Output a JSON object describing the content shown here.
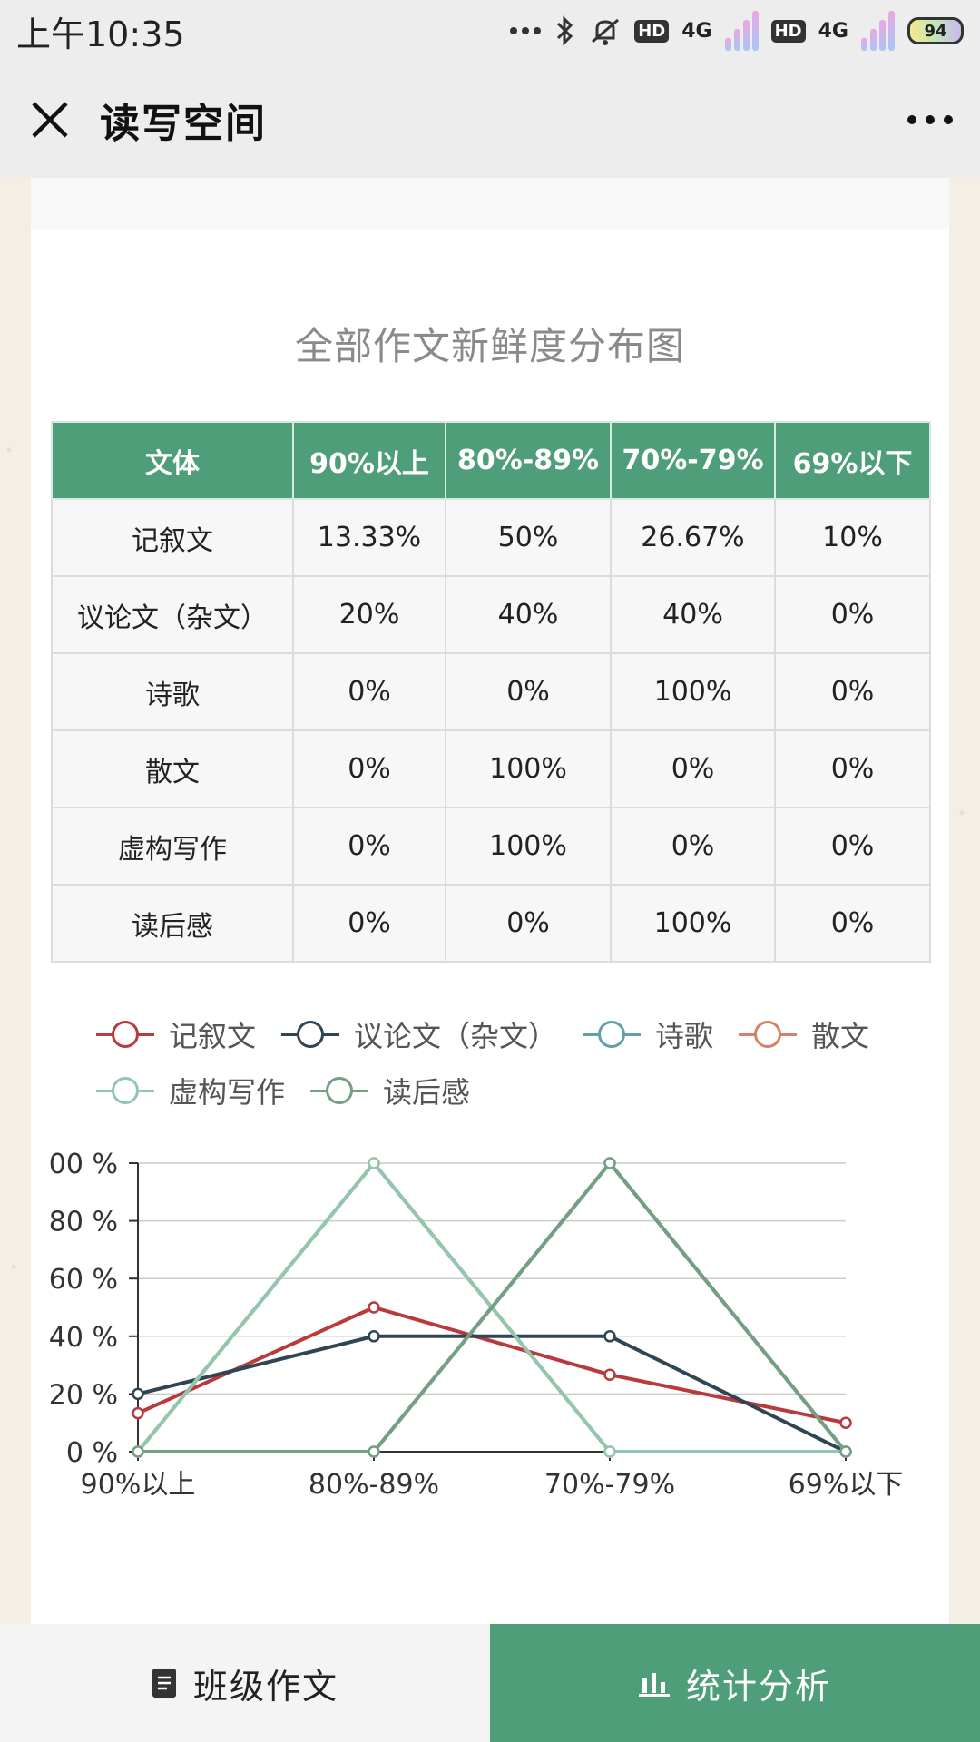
{
  "status_bar": {
    "time": "上午10:35",
    "battery": "94",
    "network_1": "4G",
    "network_2": "4G",
    "hd_1": "HD",
    "hd_2": "HD"
  },
  "header": {
    "title": "读写空间"
  },
  "chart_title": "全部作文新鲜度分布图",
  "table": {
    "headers": [
      "文体",
      "90%以上",
      "80%-89%",
      "70%-79%",
      "69%以下"
    ],
    "rows": [
      [
        "记叙文",
        "13.33%",
        "50%",
        "26.67%",
        "10%"
      ],
      [
        "议论文（杂文）",
        "20%",
        "40%",
        "40%",
        "0%"
      ],
      [
        "诗歌",
        "0%",
        "0%",
        "100%",
        "0%"
      ],
      [
        "散文",
        "0%",
        "100%",
        "0%",
        "0%"
      ],
      [
        "虚构写作",
        "0%",
        "100%",
        "0%",
        "0%"
      ],
      [
        "读后感",
        "0%",
        "0%",
        "100%",
        "0%"
      ]
    ]
  },
  "colors": {
    "accent": "#4e9e7a",
    "header_bg": "#ededed"
  },
  "chart_data": {
    "type": "line",
    "categories": [
      "90%以上",
      "80%-89%",
      "70%-79%",
      "69%以下"
    ],
    "y_tick_labels": [
      "0 %",
      "20 %",
      "40 %",
      "60 %",
      "80 %",
      "00 %"
    ],
    "ylim": [
      0,
      100
    ],
    "grid": true,
    "legend_position": "top",
    "series": [
      {
        "name": "记叙文",
        "color": "#b83a3c",
        "values": [
          13.33,
          50,
          26.67,
          10
        ]
      },
      {
        "name": "议论文（杂文）",
        "color": "#2f4554",
        "values": [
          20,
          40,
          40,
          0
        ]
      },
      {
        "name": "诗歌",
        "color": "#61a0a8",
        "values": [
          0,
          0,
          100,
          0
        ]
      },
      {
        "name": "散文",
        "color": "#d48265",
        "values": [
          0,
          100,
          0,
          0
        ]
      },
      {
        "name": "虚构写作",
        "color": "#91c7ae",
        "values": [
          0,
          100,
          0,
          0
        ]
      },
      {
        "name": "读后感",
        "color": "#749f83",
        "values": [
          0,
          0,
          100,
          0
        ]
      }
    ]
  },
  "bottom_nav": {
    "left_label": "班级作文",
    "right_label": "统计分析"
  }
}
